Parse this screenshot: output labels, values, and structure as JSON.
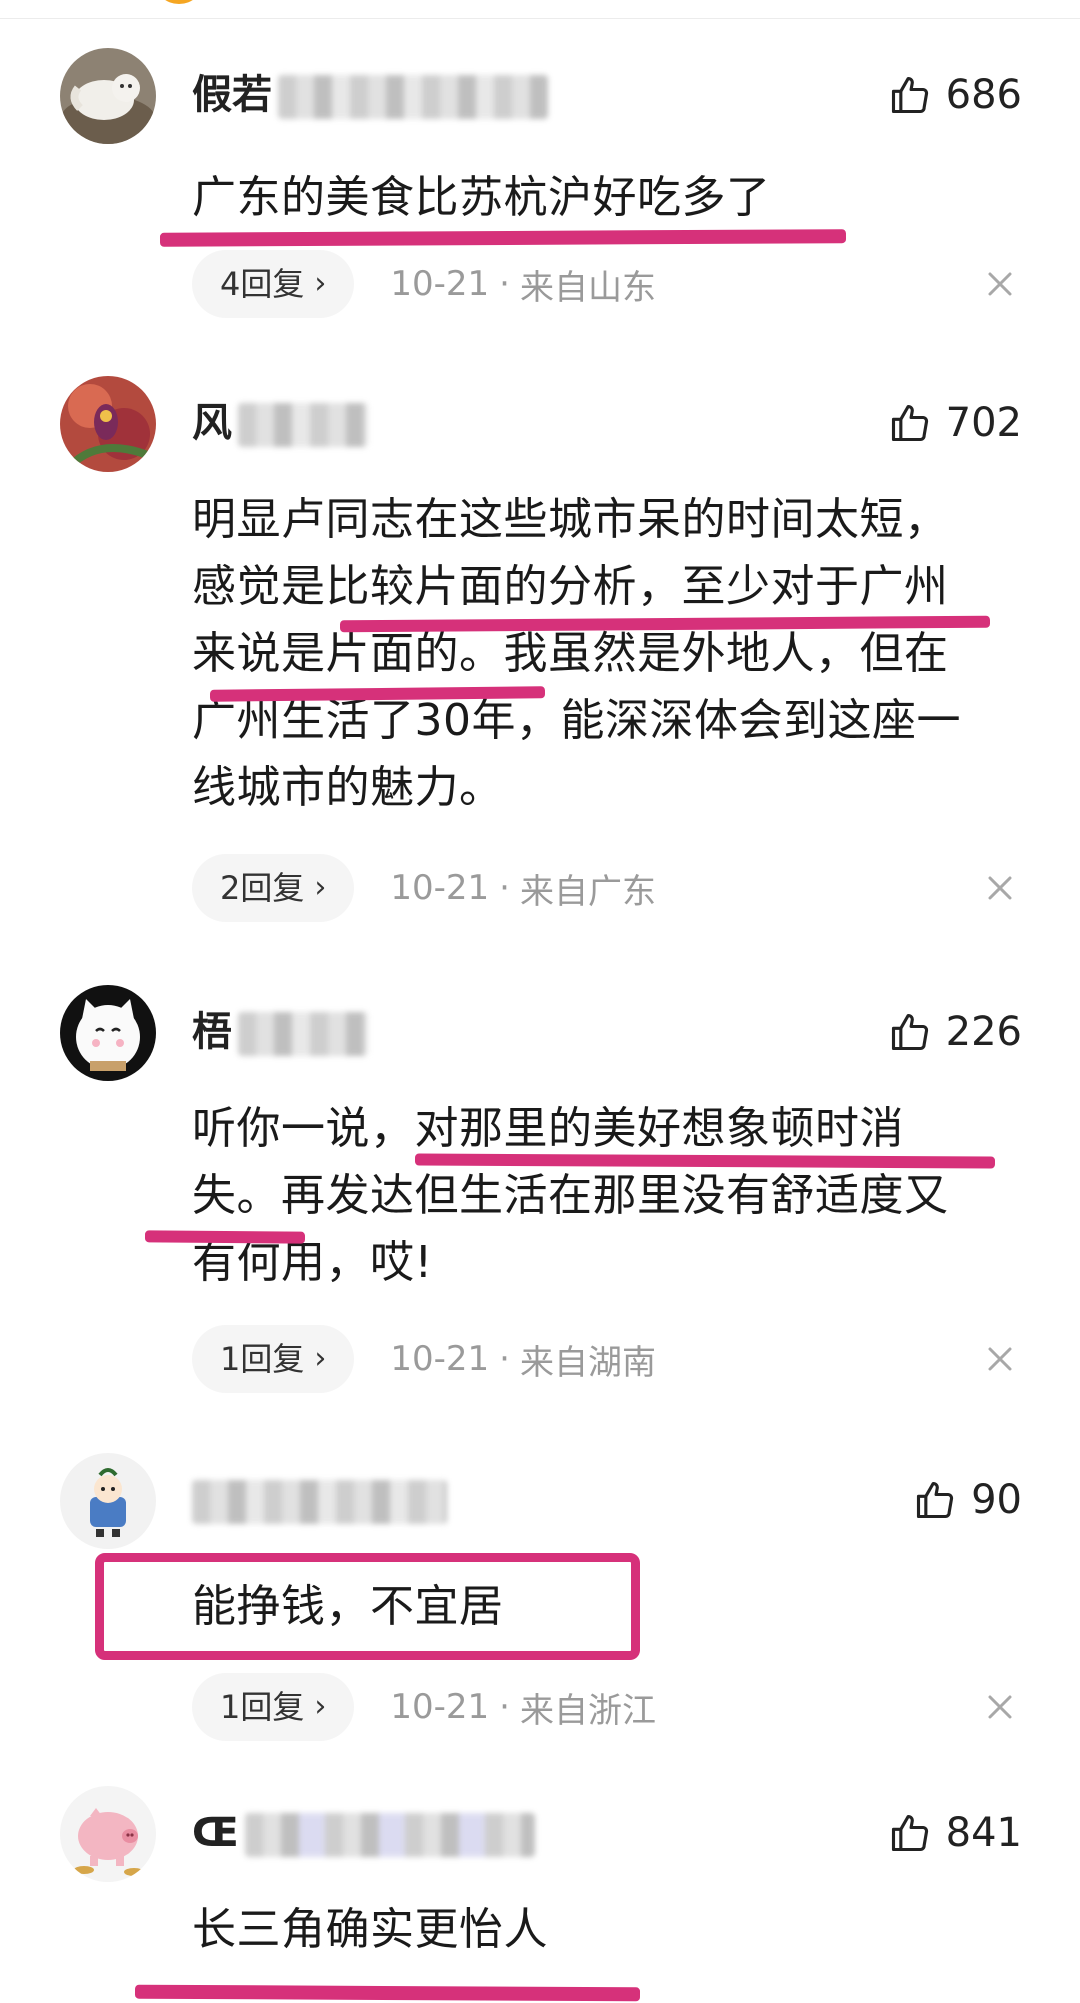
{
  "comments": [
    {
      "username": "假若",
      "likes": "686",
      "lines": [
        "广东的美食比苏杭沪好吃多了"
      ],
      "reply_label": "4回复",
      "date": "10-21",
      "location": "来自山东"
    },
    {
      "username": "风",
      "likes": "702",
      "lines": [
        "明显卢同志在这些城市呆的时间太短，",
        "感觉是比较片面的分析，至少对于广州",
        "来说是片面的。我虽然是外地人，但在",
        "广州生活了30年，能深深体会到这座一",
        "线城市的魅力。"
      ],
      "reply_label": "2回复",
      "date": "10-21",
      "location": "来自广东"
    },
    {
      "username": "梧",
      "likes": "226",
      "lines": [
        "听你一说，对那里的美好想象顿时消",
        "失。再发达但生活在那里没有舒适度又",
        "有何用，哎!"
      ],
      "reply_label": "1回复",
      "date": "10-21",
      "location": "来自湖南"
    },
    {
      "username": "",
      "likes": "90",
      "lines": [
        "能挣钱，不宜居"
      ],
      "reply_label": "1回复",
      "date": "10-21",
      "location": "来自浙江"
    },
    {
      "username": "Œ",
      "likes": "841",
      "lines": [
        "长三角确实更怡人"
      ]
    }
  ],
  "colors": {
    "highlight": "#d6317a",
    "meta_text": "#9a9a9a",
    "pill_bg": "#f5f5f5"
  },
  "icons": {
    "like": "thumbs-up-icon",
    "reply_arrow": "chevron-right-icon",
    "dismiss": "close-icon"
  },
  "separator": "·",
  "reply_chevron": "›"
}
